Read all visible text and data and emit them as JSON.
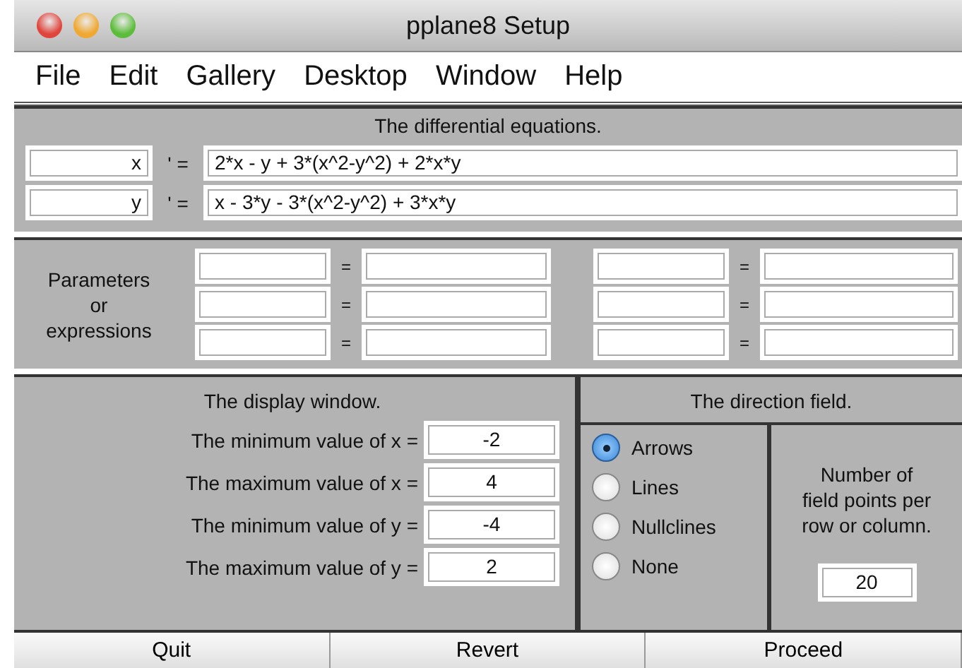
{
  "window": {
    "title": "pplane8 Setup"
  },
  "menu": [
    "File",
    "Edit",
    "Gallery",
    "Desktop",
    "Window",
    "Help"
  ],
  "equations": {
    "title": "The differential equations.",
    "rows": [
      {
        "variable": "x",
        "sign": "' =",
        "expression": "2*x - y + 3*(x^2-y^2) + 2*x*y"
      },
      {
        "variable": "y",
        "sign": "' =",
        "expression": "x - 3*y - 3*(x^2-y^2) + 3*x*y"
      }
    ]
  },
  "parameters": {
    "label": "Parameters\nor\nexpressions",
    "rows": [
      {
        "sign_left": "=",
        "sign_right": "="
      },
      {
        "sign_left": "=",
        "sign_right": "="
      },
      {
        "sign_left": "=",
        "sign_right": "="
      }
    ]
  },
  "display_window": {
    "title": "The display window.",
    "rows": [
      {
        "label": "The minimum value of x =",
        "value": "-2"
      },
      {
        "label": "The maximum value of x =",
        "value": "4"
      },
      {
        "label": "The minimum value of y =",
        "value": "-4"
      },
      {
        "label": "The maximum value of y =",
        "value": "2"
      }
    ]
  },
  "direction_field": {
    "title": "The direction field.",
    "options": [
      {
        "label": "Arrows",
        "selected": true
      },
      {
        "label": "Lines",
        "selected": false
      },
      {
        "label": "Nullclines",
        "selected": false
      },
      {
        "label": "None",
        "selected": false
      }
    ],
    "points_label": "Number of\nfield points per\nrow or column.",
    "points_value": "20"
  },
  "buttons": [
    "Quit",
    "Revert",
    "Proceed"
  ]
}
